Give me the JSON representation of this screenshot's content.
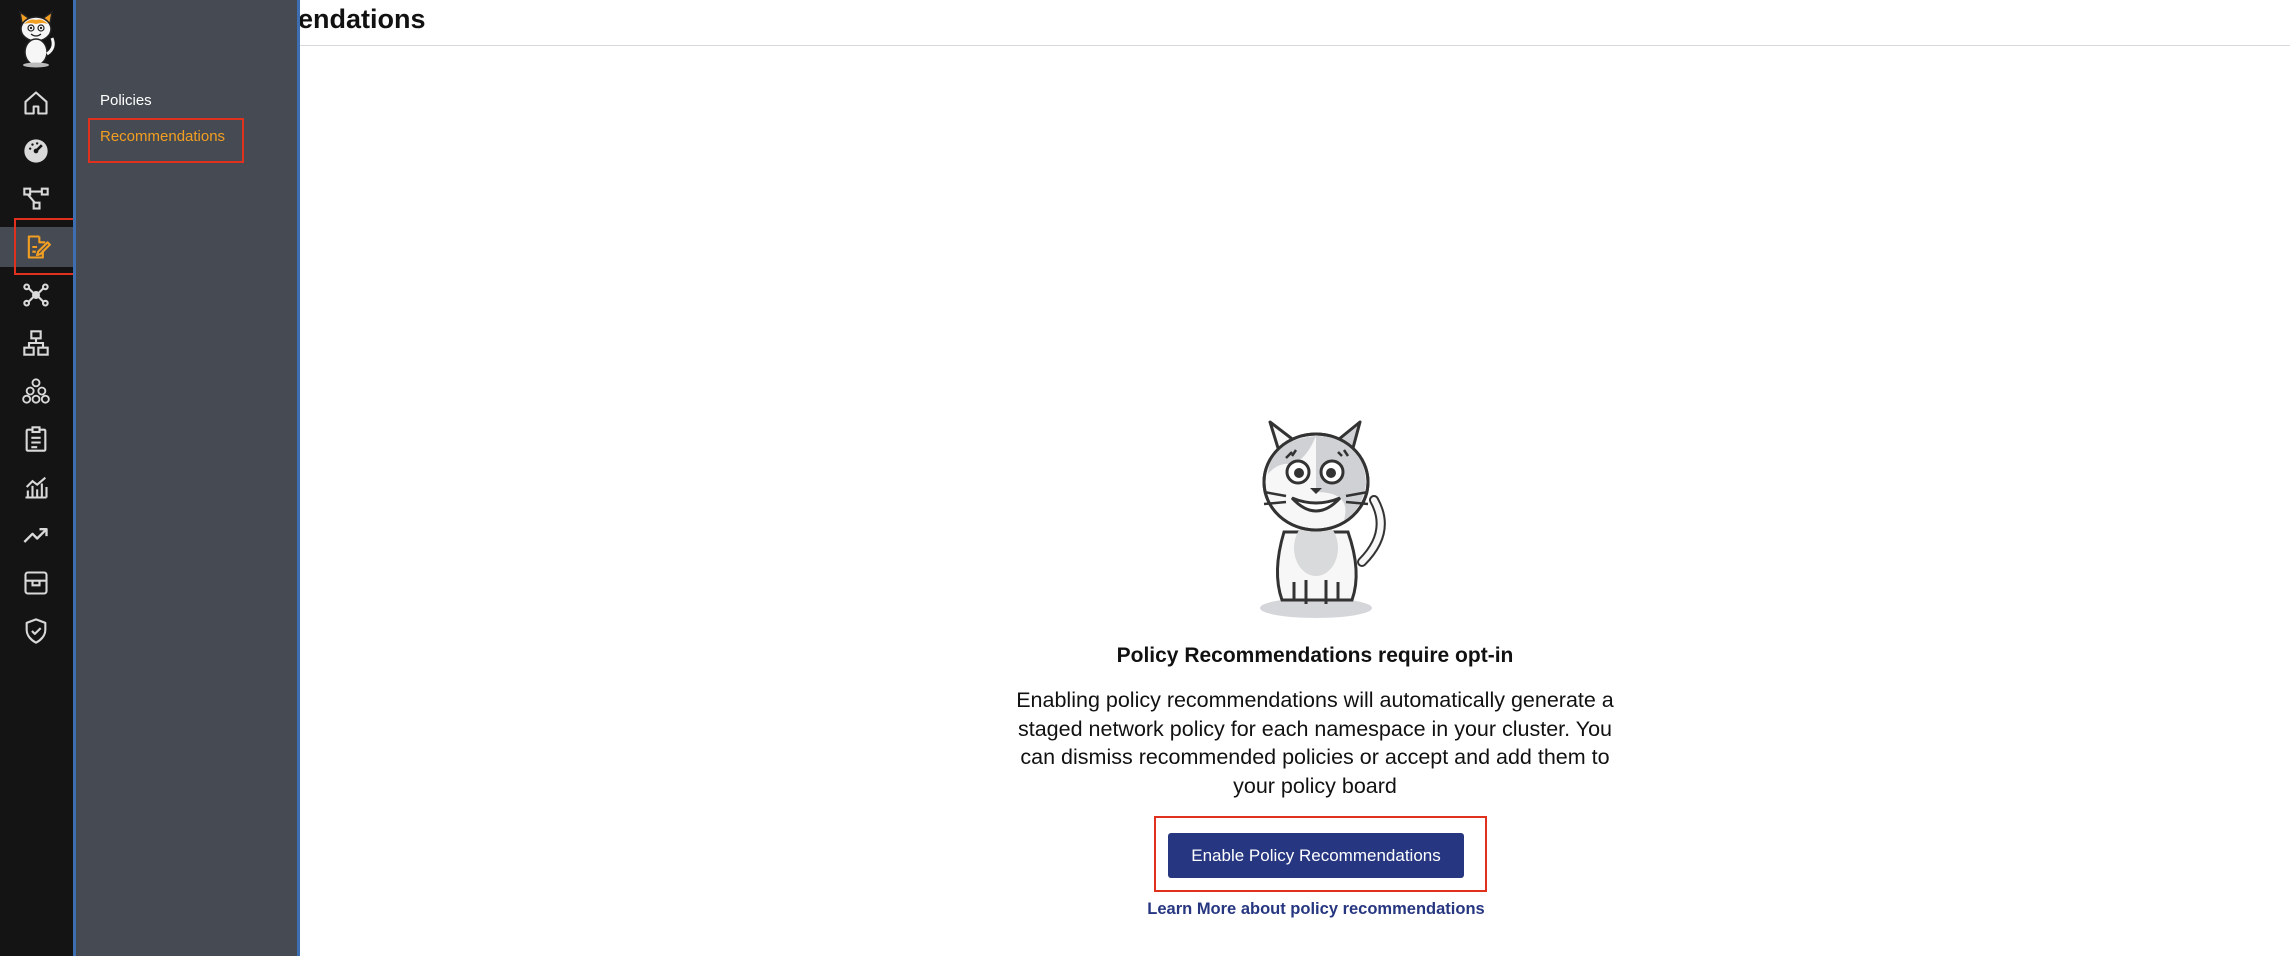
{
  "header": {
    "title": "Recommendations"
  },
  "rail": {
    "items": [
      {
        "name": "home-icon"
      },
      {
        "name": "dashboard-icon"
      },
      {
        "name": "service-graph-icon"
      },
      {
        "name": "policies-icon",
        "active": true
      },
      {
        "name": "network-icon"
      },
      {
        "name": "endpoints-icon"
      },
      {
        "name": "managed-clusters-icon"
      },
      {
        "name": "compliance-icon"
      },
      {
        "name": "reports-icon"
      },
      {
        "name": "activity-icon"
      },
      {
        "name": "threat-icon"
      },
      {
        "name": "security-icon"
      }
    ]
  },
  "flyout": {
    "items": [
      {
        "label": "Policies"
      },
      {
        "label": "Recommendations",
        "active": true
      }
    ]
  },
  "empty_state": {
    "title": "Policy Recommendations require opt-in",
    "body": "Enabling policy recommendations will automatically generate a staged network policy for each namespace in your cluster. You can dismiss recommended policies or accept and add them to your policy board",
    "button_label": "Enable Policy Recommendations",
    "link_label": "Learn More about policy recommendations"
  },
  "colors": {
    "rail_bg": "#141414",
    "flyout_bg": "#464a52",
    "accent_orange": "#f29f22",
    "primary_button": "#263680",
    "highlight_red": "#e0311f"
  }
}
